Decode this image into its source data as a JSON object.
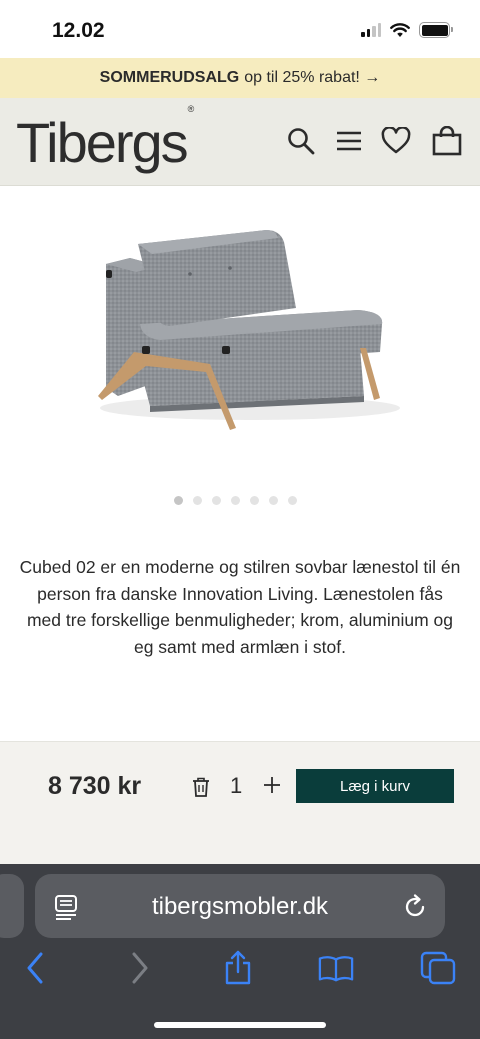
{
  "status_bar": {
    "time": "12.02"
  },
  "promo": {
    "bold": "SOMMERUDSALG",
    "rest": "op til 25% rabat! →"
  },
  "header": {
    "logo": "Tibergs",
    "logo_mark": "®",
    "icons": [
      "search-icon",
      "menu-icon",
      "heart-icon",
      "bag-icon"
    ]
  },
  "gallery": {
    "image_name": "Cubed 02 sovbar lænestol",
    "dot_count": 7,
    "active_dot": 0
  },
  "product": {
    "description": "Cubed 02 er en moderne og stilren sovbar lænestol til én person fra danske Innovation Living. Lænestolen fås med tre forskellige benmuligheder; krom, aluminium og eg samt med armlæn i stof."
  },
  "buy_bar": {
    "price": "8 730 kr",
    "quantity": "1",
    "add_to_cart_label": "Læg i kurv"
  },
  "browser": {
    "url": "tibergsmobler.dk"
  },
  "colors": {
    "promo_bg": "#f6ecbf",
    "header_bg": "#ebebe5",
    "cta_bg": "#0a3d3b",
    "browser_bg": "#3d3f44",
    "safari_blue": "#3b82f6"
  }
}
